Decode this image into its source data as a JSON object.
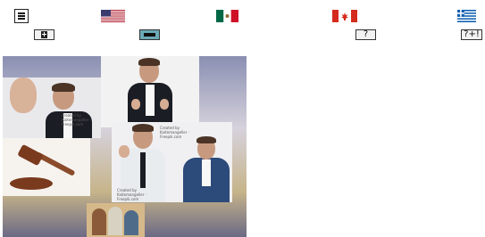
{
  "toolbar": {
    "menu_icon": "hamburger-menu-icon",
    "flags": [
      "us-flag-icon",
      "mexico-flag-icon",
      "canada-flag-icon",
      "greece-flag-icon"
    ],
    "buttons": {
      "book_icon": "book-icon",
      "bar_icon": "bar-icon",
      "help_label": "?",
      "help_plus_label": "?+!"
    }
  },
  "collage": {
    "captions": [
      "Created by Kaitemangeller · Freepik.com",
      "Created by Kaitemangeller · Freepik.com",
      "Created by Kaitemangeller · Freepik.com"
    ],
    "colors": {
      "suit": "#1b1d24",
      "skin": "#c79a80",
      "gavel": "#7a3a1d",
      "blue_suit": "#2c4a7a"
    }
  }
}
